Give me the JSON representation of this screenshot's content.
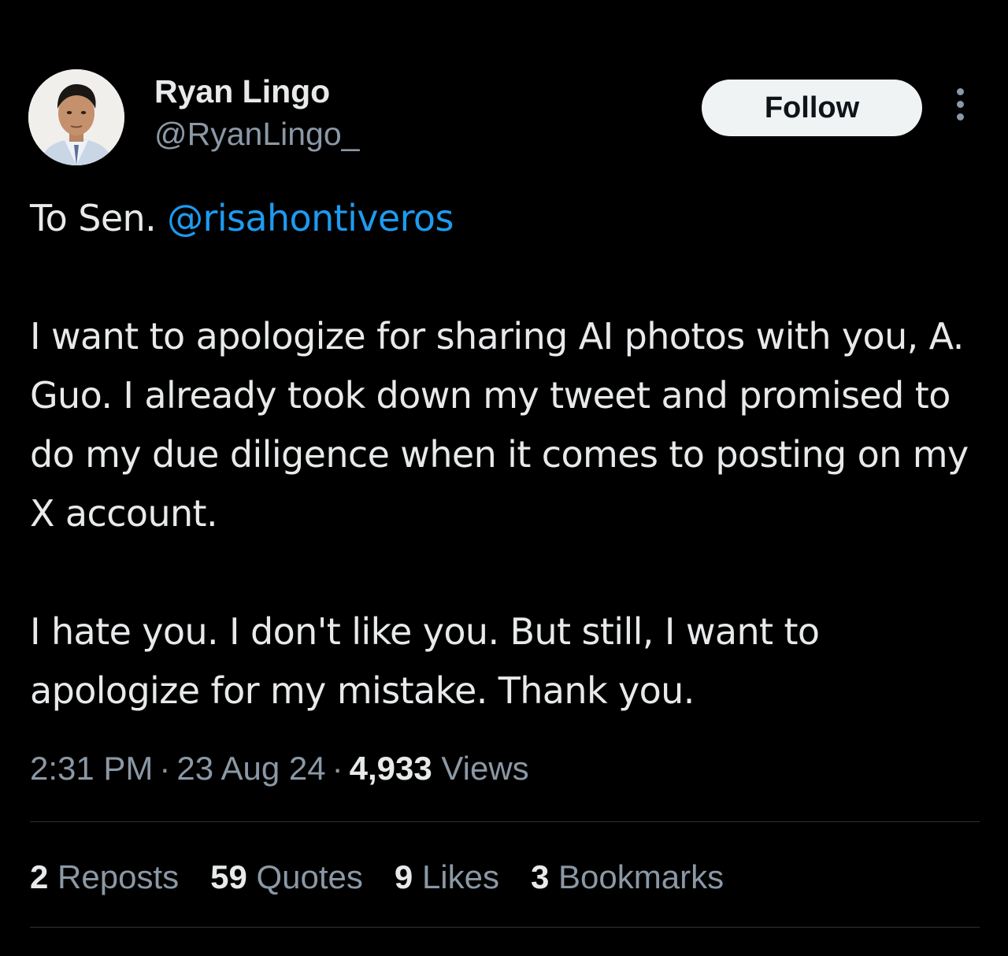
{
  "author": {
    "display_name": "Ryan Lingo",
    "handle": "@RyanLingo_",
    "avatar_icon": "profile-photo"
  },
  "header": {
    "follow_label": "Follow",
    "more_icon": "more-vertical-icon"
  },
  "tweet": {
    "line1_prefix": "To Sen. ",
    "mention": "@risahontiveros",
    "paragraph2": "I want to apologize for sharing AI photos with you, A. Guo. I already took down my tweet and promised to do my due diligence when it comes to posting on my X account.",
    "paragraph3": "I hate you. I don't like you. But still, I want to apologize for my mistake. Thank you."
  },
  "meta": {
    "time": "2:31 PM",
    "separator": "·",
    "date": "23 Aug 24",
    "views_count": "4,933",
    "views_label": "Views"
  },
  "stats": {
    "reposts": {
      "count": "2",
      "label": "Reposts"
    },
    "quotes": {
      "count": "59",
      "label": "Quotes"
    },
    "likes": {
      "count": "9",
      "label": "Likes"
    },
    "bookmarks": {
      "count": "3",
      "label": "Bookmarks"
    }
  },
  "colors": {
    "background": "#000000",
    "text_primary": "#e7e9ea",
    "text_secondary": "#8b98a5",
    "link": "#1d9bf0",
    "divider": "#2f3336",
    "follow_button_bg": "#eff3f4"
  }
}
